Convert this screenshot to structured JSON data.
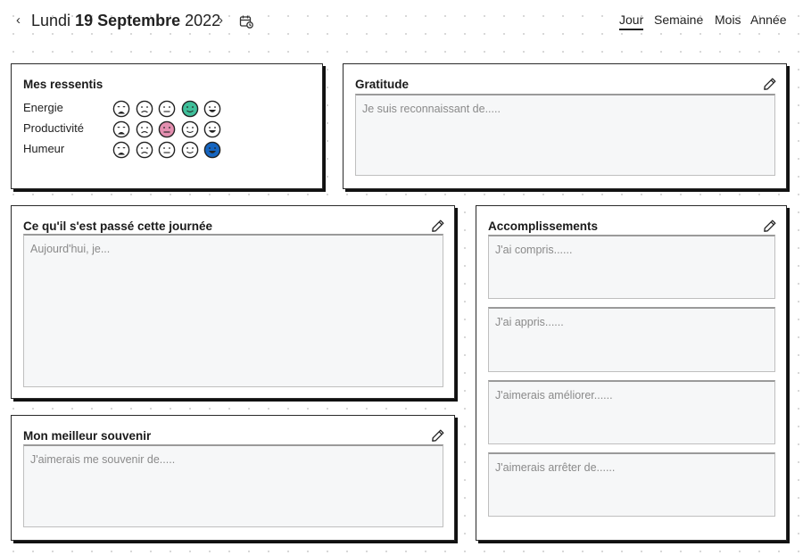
{
  "header": {
    "prev_arrow": "‹",
    "next_arrow": "›",
    "day_name": "Lundi",
    "day_month": "19 Septembre",
    "year": "2022",
    "calendar_icon": "calendar-icon",
    "views": [
      {
        "label": "Jour",
        "active": true
      },
      {
        "label": "Semaine",
        "active": false
      },
      {
        "label": "Mois",
        "active": false
      },
      {
        "label": "Année",
        "active": false
      }
    ]
  },
  "mood": {
    "title": "Mes ressentis",
    "rows": [
      {
        "label": "Energie",
        "selected": 3,
        "selected_color": "#3fbf9a"
      },
      {
        "label": "Productivité",
        "selected": 2,
        "selected_color": "#e48fb0"
      },
      {
        "label": "Humeur",
        "selected": 4,
        "selected_color": "#1565c0"
      }
    ],
    "faces": [
      "very-sad-face-icon",
      "sad-face-icon",
      "neutral-face-icon",
      "smile-face-icon",
      "happy-face-icon"
    ]
  },
  "gratitude": {
    "title": "Gratitude",
    "placeholder": "Je suis reconnaissant de....."
  },
  "day_summary": {
    "title": "Ce qu'il s'est passé cette journée",
    "placeholder": "Aujourd'hui, je..."
  },
  "best_memory": {
    "title": "Mon meilleur souvenir",
    "placeholder": "J'aimerais me souvenir de....."
  },
  "accomplishments": {
    "title": "Accomplissements",
    "fields": [
      {
        "placeholder": "J'ai compris......"
      },
      {
        "placeholder": "J'ai appris......"
      },
      {
        "placeholder": "J'aimerais améliorer......"
      },
      {
        "placeholder": "J'aimerais arrêter de......"
      }
    ]
  },
  "colors": {
    "border": "#2a2a2a",
    "textbox_bg": "#f6f7f8",
    "energy_selected": "#3fbf9a",
    "productivity_selected": "#e48fb0",
    "mood_selected": "#1565c0"
  }
}
